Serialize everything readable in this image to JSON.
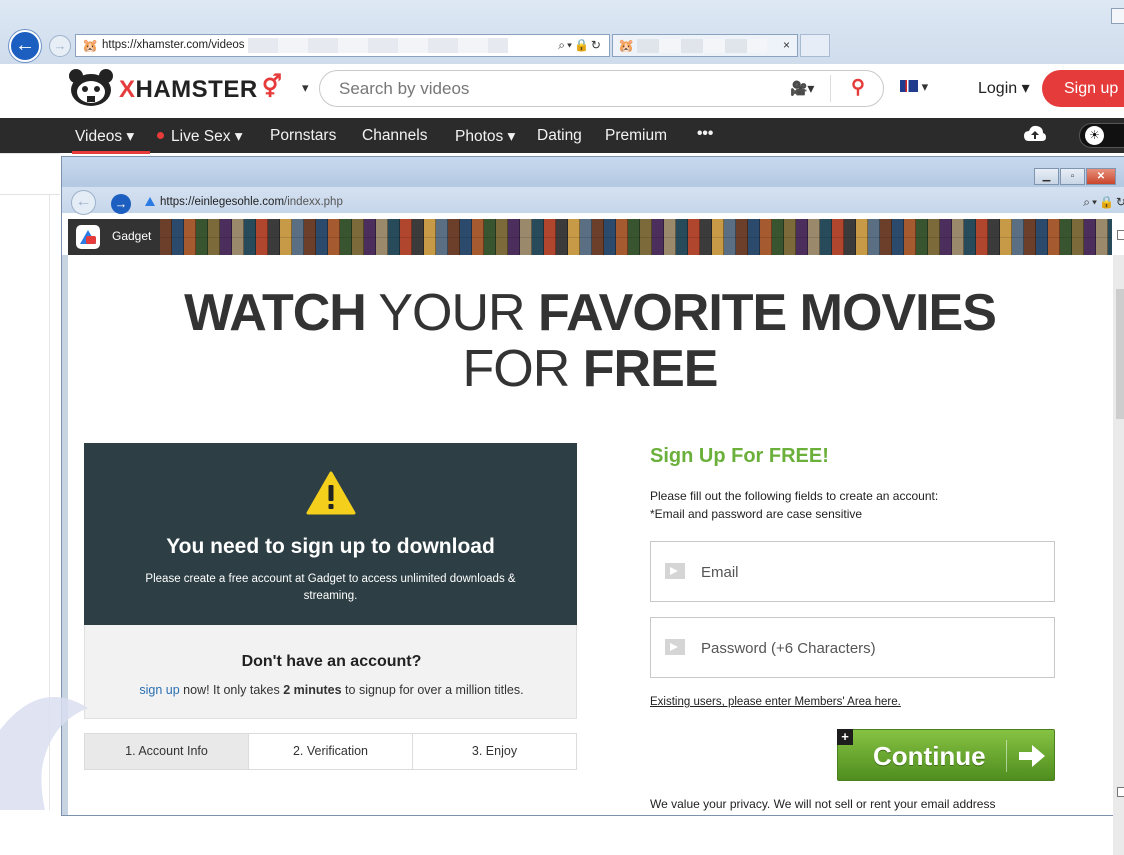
{
  "outer_browser": {
    "url": "https://xhamster.com/videos"
  },
  "site": {
    "logo_text_x": "X",
    "logo_text_rest": "HAMSTER",
    "search_placeholder": "Search by videos",
    "login_label": "Login",
    "login_caret": "▾",
    "signup_label": "Sign up"
  },
  "nav": {
    "items": [
      "Videos",
      "Live Sex",
      "Pornstars",
      "Channels",
      "Photos",
      "Dating",
      "Premium",
      "•••"
    ],
    "videos_caret": "Videos ▾",
    "live_caret": "Live Sex ▾",
    "photos_caret": "Photos ▾"
  },
  "popup": {
    "url_host": "https://einlegesohle.com",
    "url_path": "/indexx.php",
    "banner_label": "Gadget",
    "headline_line1_bold1": "WATCH",
    "headline_line1_light": " YOUR ",
    "headline_line1_bold2": "FAVORITE MOVIES",
    "headline_line2_light": "FOR ",
    "headline_line2_bold": "FREE",
    "dark_title": "You need to sign up to download",
    "dark_subtitle": "Please create a free account at Gadget to access unlimited downloads & streaming.",
    "light_title": "Don't have an account?",
    "light_link": "sign up",
    "light_text_1": " now! It only takes ",
    "light_text_bold": "2 minutes",
    "light_text_2": " to signup for over a million titles.",
    "steps": [
      "1. Account Info",
      "2. Verification",
      "3. Enjoy"
    ],
    "form_title": "Sign Up For FREE!",
    "form_desc_1": "Please fill out the following fields to create an account:",
    "form_desc_2": "*Email and password are case sensitive",
    "email_placeholder": "Email",
    "password_placeholder": "Password (+6 Characters)",
    "members_link": "Existing users, please enter Members' Area here.",
    "continue_label": "Continue",
    "privacy_text": "We value your privacy. We will not sell or rent your email address"
  },
  "colors": {
    "accent_red": "#e53b3b",
    "nav_bg": "#2b2b2b",
    "panel_dark": "#2d3f44",
    "form_green": "#6ab03a"
  }
}
